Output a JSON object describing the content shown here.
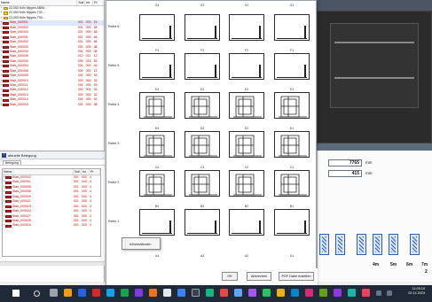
{
  "left_tree": {
    "headers": [
      "Name",
      "Soll",
      "Ist",
      "Pr"
    ],
    "rows": [
      {
        "name": "22-053 Köln Nippes AB5d...",
        "kind": "folder",
        "v": [
          "",
          "",
          ""
        ]
      },
      {
        "name": "22-053 Köln Nippes T32 ...",
        "kind": "folder",
        "v": [
          "",
          "",
          ""
        ]
      },
      {
        "name": "22-053 Köln Nippes T90...",
        "kind": "folder",
        "v": [
          "",
          "",
          ""
        ]
      },
      {
        "name": "Stab_000001",
        "kind": "bar",
        "v": [
          "001",
          "000",
          "15"
        ]
      },
      {
        "name": "Stab_000002",
        "kind": "bar",
        "v": [
          "001",
          "000",
          "48"
        ]
      },
      {
        "name": "Stab_000003",
        "kind": "bar",
        "v": [
          "001",
          "000",
          "48"
        ]
      },
      {
        "name": "Stab_000031",
        "kind": "bar",
        "v": [
          "001",
          "000",
          "48"
        ]
      },
      {
        "name": "Stab_000032",
        "kind": "bar",
        "v": [
          "001",
          "000",
          "48"
        ]
      },
      {
        "name": "Stab_000033",
        "kind": "bar",
        "v": [
          "001",
          "000",
          "38"
        ]
      },
      {
        "name": "Stab_000034",
        "kind": "bar",
        "v": [
          "001",
          "000",
          "38"
        ]
      },
      {
        "name": "Stab_000035",
        "kind": "bar",
        "v": [
          "012",
          "011",
          "12"
        ]
      },
      {
        "name": "Stab_000003",
        "kind": "bar",
        "v": [
          "009",
          "018",
          "53"
        ]
      },
      {
        "name": "Stab_000004",
        "kind": "bar",
        "v": [
          "001",
          "000",
          "49"
        ]
      },
      {
        "name": "Stab_000006",
        "kind": "bar",
        "v": [
          "009",
          "000",
          "12"
        ]
      },
      {
        "name": "Stab_000009",
        "kind": "bar",
        "v": [
          "001",
          "000",
          "49"
        ]
      },
      {
        "name": "Stab_000010",
        "kind": "bar",
        "v": [
          "009",
          "000",
          "32"
        ]
      },
      {
        "name": "Stab_000011",
        "kind": "bar",
        "v": [
          "001",
          "000",
          "49"
        ]
      },
      {
        "name": "Stab_000012",
        "kind": "bar",
        "v": [
          "002",
          "001",
          "32"
        ]
      },
      {
        "name": "Stab_000013",
        "kind": "bar",
        "v": [
          "009",
          "000",
          "32"
        ]
      },
      {
        "name": "Stab_000014",
        "kind": "bar",
        "v": [
          "001",
          "000",
          "32"
        ]
      },
      {
        "name": "Stab_000015",
        "kind": "bar",
        "v": [
          "001",
          "000",
          "38"
        ]
      }
    ]
  },
  "lower_panel": {
    "title": "aktuelle Belegung",
    "tab": "Belegung",
    "headers": [
      "Name",
      "Soll",
      "Ist",
      "Pr"
    ],
    "rows": [
      {
        "name": "Stab_000002",
        "v": [
          "001",
          "000",
          "4"
        ]
      },
      {
        "name": "Stab_000001",
        "v": [
          "001",
          "000",
          "4"
        ]
      },
      {
        "name": "Stab_000005",
        "v": [
          "001",
          "000",
          "4"
        ]
      },
      {
        "name": "Stab_000006",
        "v": [
          "001",
          "000",
          "4"
        ]
      },
      {
        "name": "Stab_000009",
        "v": [
          "001",
          "000",
          "4"
        ]
      },
      {
        "name": "Stab_000021",
        "v": [
          "001",
          "000",
          "4"
        ]
      },
      {
        "name": "Stab_000023",
        "v": [
          "001",
          "000",
          "4"
        ]
      },
      {
        "name": "Stab_000022",
        "v": [
          "001",
          "000",
          "4"
        ]
      },
      {
        "name": "Stab_000027",
        "v": [
          "001",
          "000",
          "4"
        ]
      },
      {
        "name": "Stab_000028",
        "v": [
          "001",
          "000",
          "4"
        ]
      },
      {
        "name": "Stab_000019",
        "v": [
          "001",
          "000",
          "4"
        ]
      }
    ]
  },
  "right_panel": {
    "field1_value": "7765",
    "field1_unit": "mm",
    "field2_value": "415",
    "field2_unit": "mm",
    "meter_labels": [
      "4m",
      "5m",
      "6m",
      "7m",
      "2"
    ]
  },
  "modal": {
    "row_labels": {
      "r6": "Reihe 6",
      "r5": "Reihe 5",
      "r4": "Reihe 4",
      "r3": "Reihe 3",
      "r2": "Reihe 2",
      "r1": "Reihe 1"
    },
    "top_labels": [
      "G4",
      "G3",
      "G2",
      "G1"
    ],
    "rows": [
      {
        "key": "r6",
        "labels": [
          "F4",
          "F3",
          "F2",
          "F1"
        ],
        "type": "empty"
      },
      {
        "key": "r5",
        "labels": [
          "E4",
          "E3",
          "E2",
          "E1"
        ],
        "type": "empty"
      },
      {
        "key": "r4",
        "labels": [
          "D4",
          "D3",
          "D2",
          "D1"
        ],
        "type": "frame"
      },
      {
        "key": "r3",
        "labels": [
          "C4",
          "C3",
          "C2",
          "C1"
        ],
        "type": "frame"
      },
      {
        "key": "r2",
        "labels": [
          "B4",
          "B3",
          "B2",
          "B1"
        ],
        "type": "frame"
      },
      {
        "key": "r1",
        "labels": [
          "A4",
          "A3",
          "A2",
          "A1"
        ],
        "type": "empty"
      }
    ],
    "ok_label": "OK",
    "cancel_label": "Abbrechen",
    "pdf_label": "PDF Datei erstellen",
    "context_menu_item": "Informationen"
  },
  "taskbar": {
    "time": "11:09:15",
    "date": "02.11.2023"
  },
  "colors": {
    "accent_red": "#c62828",
    "folder_yellow": "#e8c54c",
    "rack_blue": "#2f5fb3",
    "taskbar": "#1f2937"
  }
}
